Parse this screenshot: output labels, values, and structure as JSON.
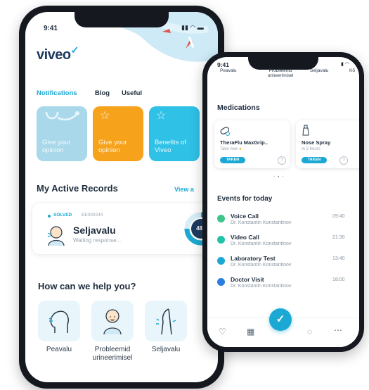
{
  "colors": {
    "accent": "#1ba9d4",
    "brand": "#1d3a5f",
    "orange": "#f7a21b",
    "cyan": "#2fc1e6",
    "light_blue": "#9fd6ea",
    "green": "#3cc48a",
    "teal": "#22c4a8",
    "blue": "#2a7de1"
  },
  "front": {
    "status_time": "9:41",
    "logo": "viveo",
    "tabs": [
      {
        "label": "Notifications",
        "active": true
      },
      {
        "label": "Blog",
        "active": false
      },
      {
        "label": "Useful",
        "active": false
      }
    ],
    "tiles": [
      {
        "text": "Give your opinion",
        "icon": "stethoscope-icon"
      },
      {
        "text": "Give your opinion",
        "icon": "star-icon"
      },
      {
        "text": "Benefits of Viveo",
        "icon": "star-icon"
      }
    ],
    "records_title": "My Active Records",
    "view_all": "View a",
    "record": {
      "status": "SOLVED",
      "code": "EE000244",
      "title": "Seljavalu",
      "subtitle": "Waiting response...",
      "timer": "48h",
      "progress": 0.75
    },
    "help_title": "How can we help you?",
    "help_items": [
      {
        "label": "Peavalu",
        "icon": "head-pain-icon"
      },
      {
        "label": "Probleemid urineerimisel",
        "icon": "urination-icon"
      },
      {
        "label": "Seljavalu",
        "icon": "back-pain-icon"
      }
    ]
  },
  "back": {
    "status_time": "9:41",
    "header_items": [
      "Peavalu",
      "Probleemid urineerimisel",
      "Seljavalu",
      "Kõ"
    ],
    "medications_title": "Medications",
    "medications": [
      {
        "name": "TheraFlu MaxGrip..",
        "sub": "Take now",
        "button": "TAKEN",
        "icon": "pills-icon"
      },
      {
        "name": "Nose Spray",
        "sub": "In 2 hours",
        "button": "TAKEN",
        "icon": "spray-icon"
      }
    ],
    "events_title": "Events for today",
    "events": [
      {
        "title": "Voice Call",
        "doctor": "Dr. Konstantin Konstantinov",
        "time": "09:40",
        "color": "#3cc48a",
        "icon": "phone-icon"
      },
      {
        "title": "Video Call",
        "doctor": "Dr. Konstantin Konstantinov",
        "time": "21:30",
        "color": "#22c4a8",
        "icon": "video-icon"
      },
      {
        "title": "Laboratory Test",
        "doctor": "Dr. Konstantin Konstantinov",
        "time": "13:40",
        "color": "#1ba9d4",
        "icon": "flask-icon"
      },
      {
        "title": "Doctor Visit",
        "doctor": "Dr. Konstantin Konstantinov",
        "time": "18:00",
        "color": "#2a7de1",
        "icon": "doctor-icon"
      }
    ]
  }
}
